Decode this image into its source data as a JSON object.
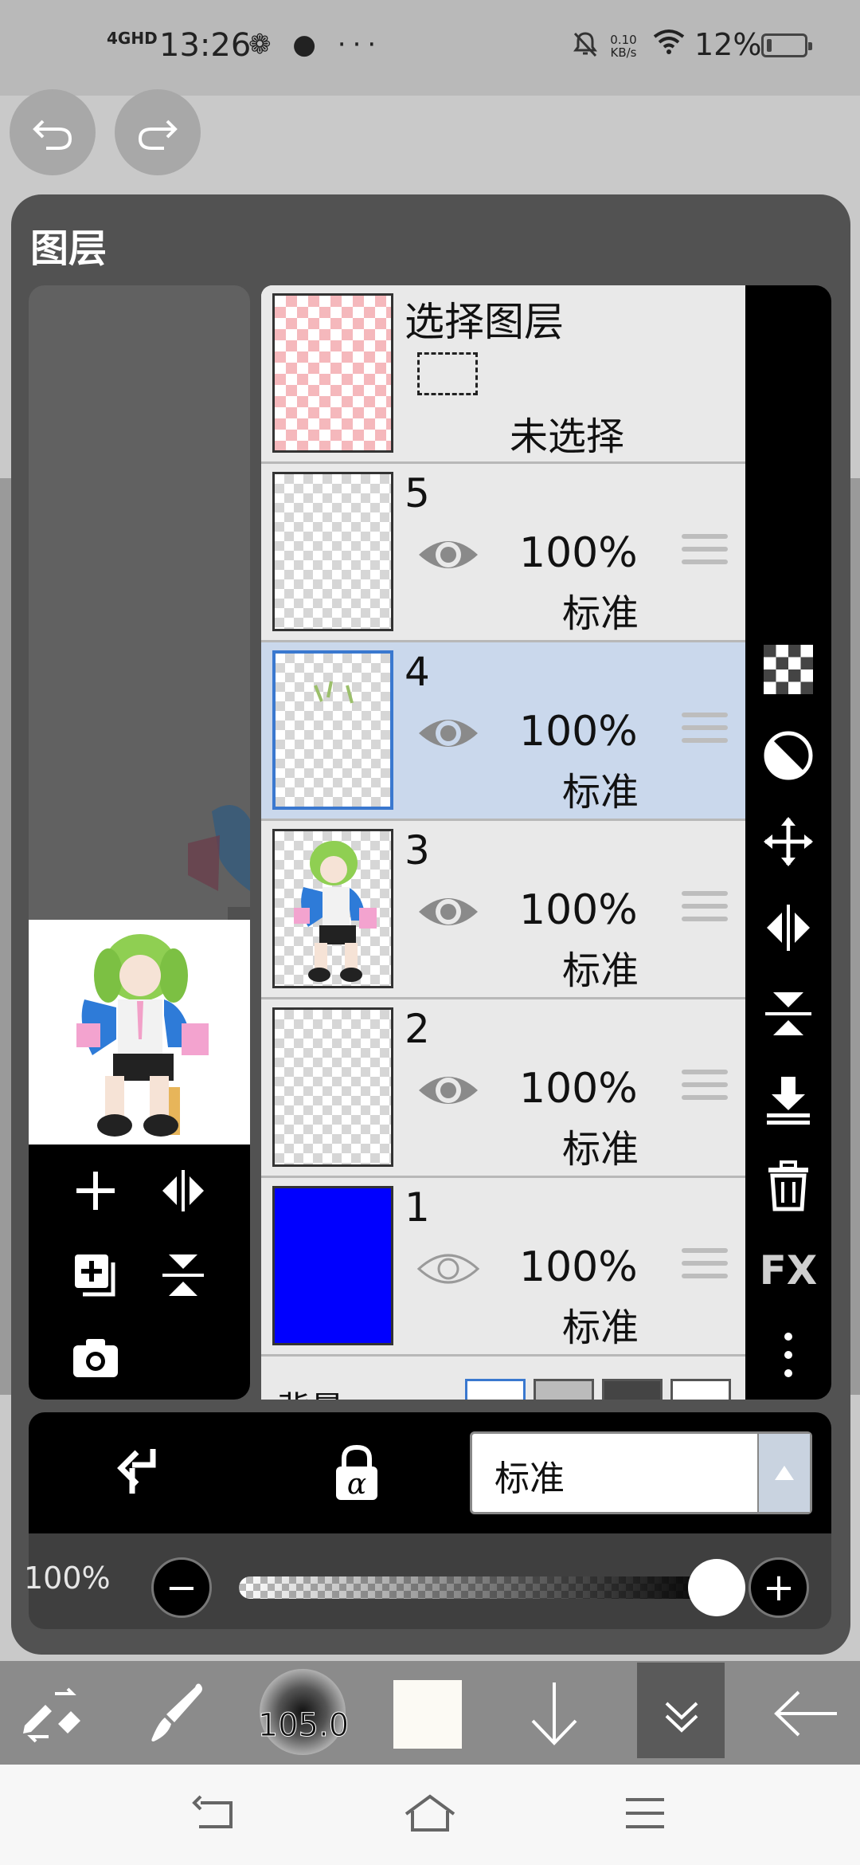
{
  "status_bar": {
    "network": "4GHD",
    "time": "13:26",
    "left_icons": "❁ ● ···",
    "speed": "0.10 KB/s",
    "battery_percent": "12%"
  },
  "panel": {
    "title": "图层"
  },
  "selection_layer": {
    "title": "选择图层",
    "status": "未选择"
  },
  "layers": [
    {
      "number": "5",
      "opacity": "100%",
      "blend": "标准",
      "visible": true,
      "selected": false
    },
    {
      "number": "4",
      "opacity": "100%",
      "blend": "标准",
      "visible": true,
      "selected": true
    },
    {
      "number": "3",
      "opacity": "100%",
      "blend": "标准",
      "visible": true,
      "selected": false
    },
    {
      "number": "2",
      "opacity": "100%",
      "blend": "标准",
      "visible": true,
      "selected": false
    },
    {
      "number": "1",
      "opacity": "100%",
      "blend": "标准",
      "visible": false,
      "selected": false,
      "fill_color": "#0000ff"
    }
  ],
  "background_row": {
    "label": "背景"
  },
  "right_tools": {
    "fx_label": "FX"
  },
  "bottom_bar": {
    "blend_mode": "标准"
  },
  "opacity_control": {
    "label": "100%",
    "value": 1.0
  },
  "toolbar": {
    "brush_size": "105.0",
    "current_color": "#fcfaf4"
  }
}
